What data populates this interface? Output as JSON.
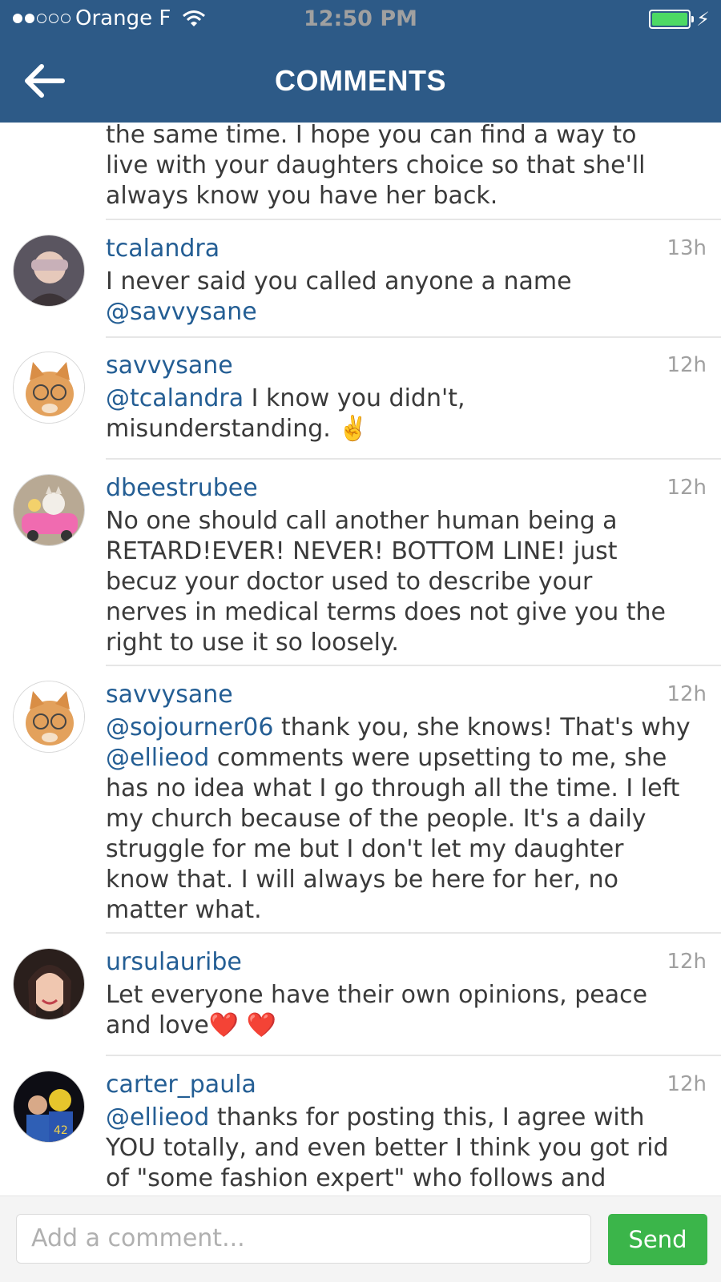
{
  "status": {
    "carrier": "Orange F",
    "time": "12:50 PM",
    "signal_dots_filled": 2,
    "signal_dots_total": 5
  },
  "nav": {
    "title": "COMMENTS"
  },
  "partial_comment": {
    "lines": [
      "the same time.  I hope you can find a way to",
      "live with your daughters choice so that she'll",
      "always know you have her back."
    ]
  },
  "comments": [
    {
      "username": "tcalandra",
      "time": "13h",
      "text": "I never said you called anyone a name",
      "mention": "@savvysane"
    },
    {
      "username": "savvysane",
      "time": "12h",
      "mention": "@tcalandra",
      "text1": " I know you didn't,",
      "text2": "misunderstanding. ",
      "emoji": "✌️"
    },
    {
      "username": "dbeestrubee",
      "time": "12h",
      "lines": [
        "No one should call another human being a",
        "RETARD!EVER! NEVER! BOTTOM LINE! just",
        "becuz  your doctor used to describe your",
        "nerves in medical terms does not give you the",
        "right to use it so loosely."
      ]
    },
    {
      "username": "savvysane",
      "time": "12h",
      "mention1": "@sojourner06",
      "t1": " thank you, she knows! That's why",
      "mention2": "@ellieod",
      "t2": " comments were upsetting to me, she",
      "lines": [
        "has no idea what I go through all the time. I left",
        "my church because of the people. It's a daily",
        "struggle for me but I don't let my daughter",
        "know that. I will always be here for her, no",
        "matter what."
      ]
    },
    {
      "username": "ursulauribe",
      "time": "12h",
      "line1": "Let everyone have their own opinions, peace",
      "line2": "and love",
      "emoji": "❤️ ❤️"
    },
    {
      "username": "carter_paula",
      "time": "12h",
      "mention": "@ellieod",
      "t1": " thanks for posting this, I agree with",
      "line2": "YOU totally, and even better I think you got rid",
      "line3": "of \"some fashion expert\" who follows and"
    }
  ],
  "composer": {
    "placeholder": "Add a comment...",
    "send_label": "Send",
    "send_color": "#3bb54a"
  },
  "colors": {
    "bar": "#2d5a87",
    "link": "#245e94"
  }
}
